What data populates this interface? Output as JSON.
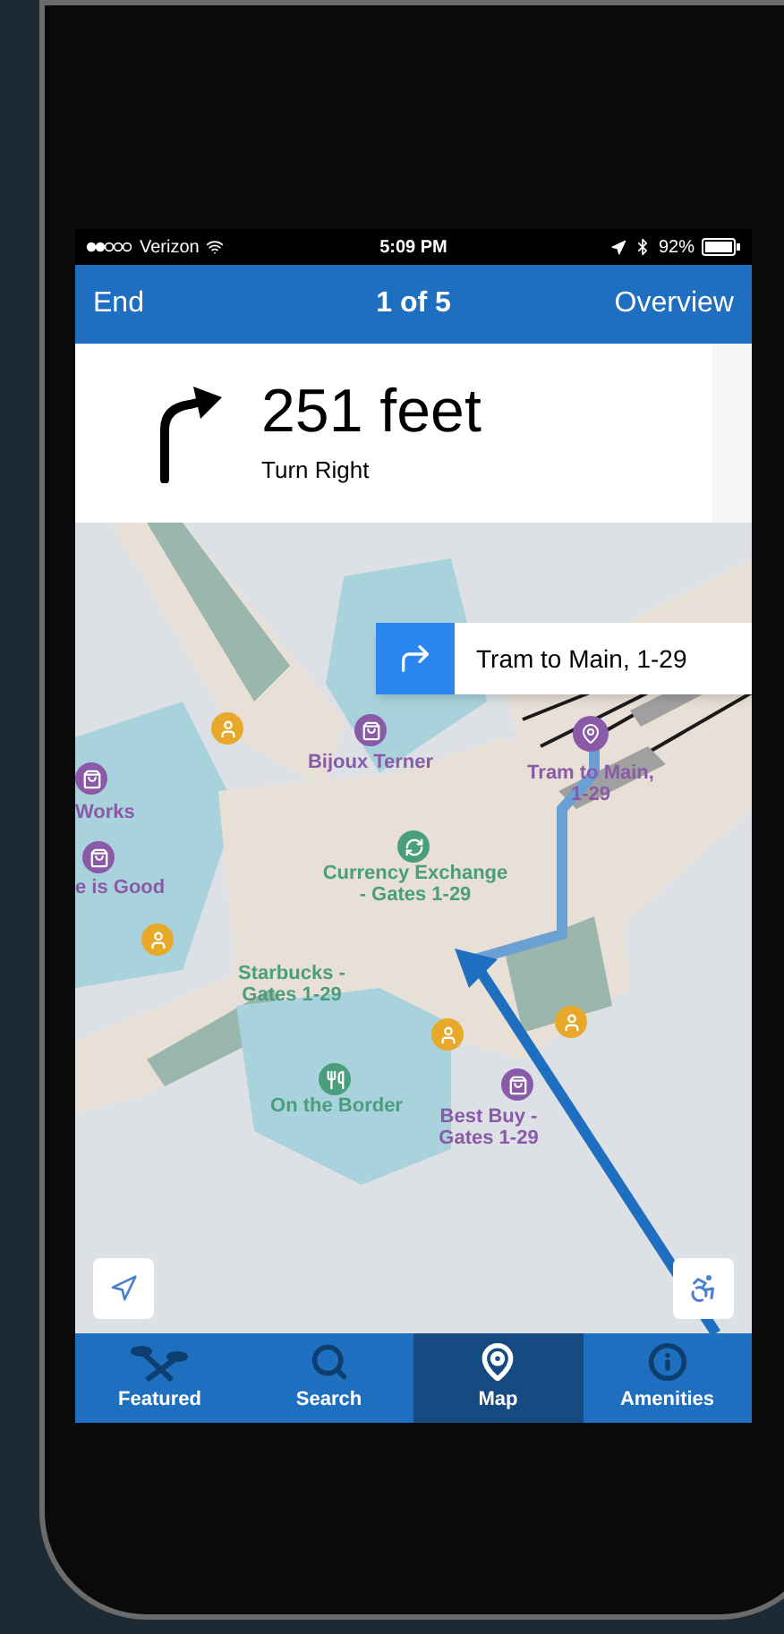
{
  "status_bar": {
    "carrier": "Verizon",
    "time": "5:09 PM",
    "battery": "92%"
  },
  "nav_bar": {
    "left": "End",
    "title": "1 of 5",
    "right": "Overview"
  },
  "direction": {
    "distance": "251 feet",
    "instruction": "Turn Right"
  },
  "callout": {
    "text": "Tram to Main, 1-29"
  },
  "map_labels": [
    {
      "text": "Works",
      "color": "#8a5aa8"
    },
    {
      "text": "e is Good",
      "color": "#8a5aa8"
    },
    {
      "text": "Bijoux Terner",
      "color": "#8a5aa8"
    },
    {
      "text": "Tram to Main, 1-29",
      "color": "#8a5aa8"
    },
    {
      "text": "Currency Exchange - Gates 1-29",
      "color": "#4a9e7e"
    },
    {
      "text": "Starbucks - Gates 1-29",
      "color": "#4a9e7e"
    },
    {
      "text": "On the Border",
      "color": "#4a9e7e"
    },
    {
      "text": "Best Buy - Gates 1-29",
      "color": "#8a5aa8"
    }
  ],
  "tabs": [
    {
      "label": "Featured",
      "selected": false
    },
    {
      "label": "Search",
      "selected": false
    },
    {
      "label": "Map",
      "selected": true
    },
    {
      "label": "Amenities",
      "selected": false
    }
  ]
}
